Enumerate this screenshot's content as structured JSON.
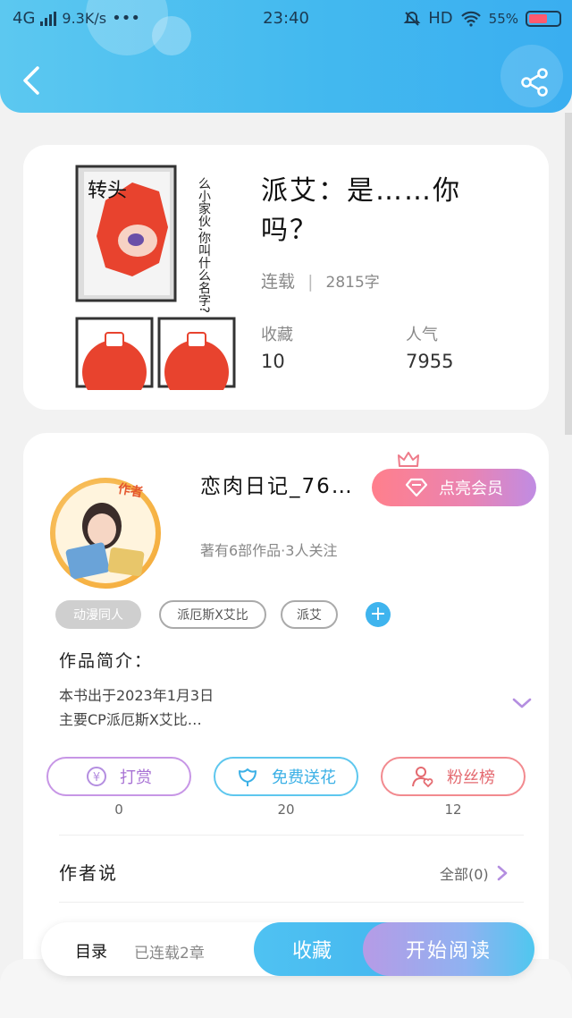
{
  "status_bar": {
    "network": "4G",
    "speed": "9.3K/s",
    "dots": "•••",
    "time": "23:40",
    "hd": "HD",
    "battery": "55%"
  },
  "colors": {
    "header_start": "#5cc8f0",
    "header_end": "#3aaef0",
    "vip_start": "#ff7f8c",
    "vip_end": "#c08ce3",
    "tip": "#c796e6",
    "flower": "#5ec7ee",
    "fans": "#f28a8f"
  },
  "header": {
    "back_icon": "chevron-left-icon",
    "share_icon": "share-icon"
  },
  "book": {
    "cover_text_top": "转头",
    "cover_text_side": "么小家伙,你叫什么名字?",
    "title": "派艾：是……你吗？",
    "status": "连载",
    "separator": "|",
    "word_count": "2815字",
    "favorites_label": "收藏",
    "favorites_value": "10",
    "popularity_label": "人气",
    "popularity_value": "7955"
  },
  "author": {
    "badge": "作者",
    "name": "恋肉日记_76…",
    "summary": "著有6部作品·3人关注",
    "vip_label": "点亮会员"
  },
  "tags": [
    "动漫同人",
    "派厄斯X艾比",
    "派艾"
  ],
  "intro": {
    "title": "作品简介：",
    "line1": "本书出于2023年1月3日",
    "line2": "主要CP派厄斯X艾比…"
  },
  "actions": {
    "tip_label": "打赏",
    "tip_count": "0",
    "flower_label": "免费送花",
    "flower_count": "20",
    "fans_label": "粉丝榜",
    "fans_count": "12"
  },
  "author_says": {
    "title": "作者说",
    "all_label": "全部(0)"
  },
  "bottom_bar": {
    "toc": "目录",
    "chapters": "已连载2章",
    "favorite": "收藏",
    "start_reading": "开始阅读"
  }
}
